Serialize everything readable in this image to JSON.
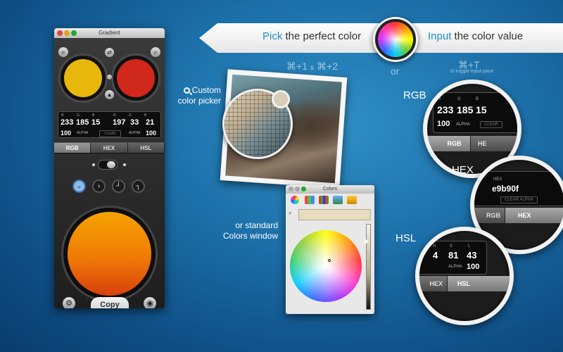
{
  "banner": {
    "pick_accent": "Pick",
    "pick_rest": "the perfect color",
    "input_accent": "Input",
    "input_rest": "the color value",
    "shortcut_pick": "⌘+1",
    "shortcut_amp": "&",
    "shortcut_pick2": "⌘+2",
    "or_text": "or",
    "shortcut_input": "⌘+T",
    "toggle_note": "to toggle input pane",
    "accent_color": "#1f8fd0"
  },
  "gradient_window": {
    "title": "Gradient",
    "left_color": "#e8b70c",
    "right_color": "#d0281a",
    "headers": [
      "R",
      "G",
      "B",
      "R",
      "G",
      "B"
    ],
    "left_values": [
      "233",
      "185",
      "15"
    ],
    "right_values": [
      "197",
      "33",
      "21"
    ],
    "left_alpha": "100",
    "right_alpha": "100",
    "alpha_label": "ALPHA",
    "clear_label": "CLEAR",
    "tabs": [
      "RGB",
      "HEX",
      "HSL"
    ],
    "active_tab": "RGB",
    "gradient_direction_icons": [
      "chevron-down-icon",
      "chevron-right-icon",
      "corner-bottom-right-icon",
      "corner-top-right-icon"
    ],
    "copy_label": "Copy"
  },
  "picker": {
    "callout_line1": "Custom",
    "callout_line2": "color picker",
    "standard_line1": "or standard",
    "standard_line2": "Colors window"
  },
  "colors_window": {
    "title": "Colors"
  },
  "zooms": {
    "rgb": {
      "label": "RGB",
      "headers": [
        "R",
        "G",
        "B"
      ],
      "values": [
        "233",
        "185",
        "15"
      ],
      "alpha_value": "100",
      "alpha_label": "ALPHA",
      "clear_label": "CLEAR",
      "tabs": [
        "RGB",
        "HE"
      ]
    },
    "hex": {
      "label": "HEX",
      "header": "HEX",
      "value": "e9b90f",
      "clear_label": "CLEAR ALPHA",
      "tabs": [
        "RGB",
        "HEX"
      ]
    },
    "hsl": {
      "label": "HSL",
      "headers": [
        "H",
        "S",
        "L"
      ],
      "values": [
        "4",
        "81",
        "43"
      ],
      "alpha_value": "100",
      "alpha_label": "ALPHA",
      "tabs": [
        "HEX",
        "HSL"
      ]
    }
  }
}
